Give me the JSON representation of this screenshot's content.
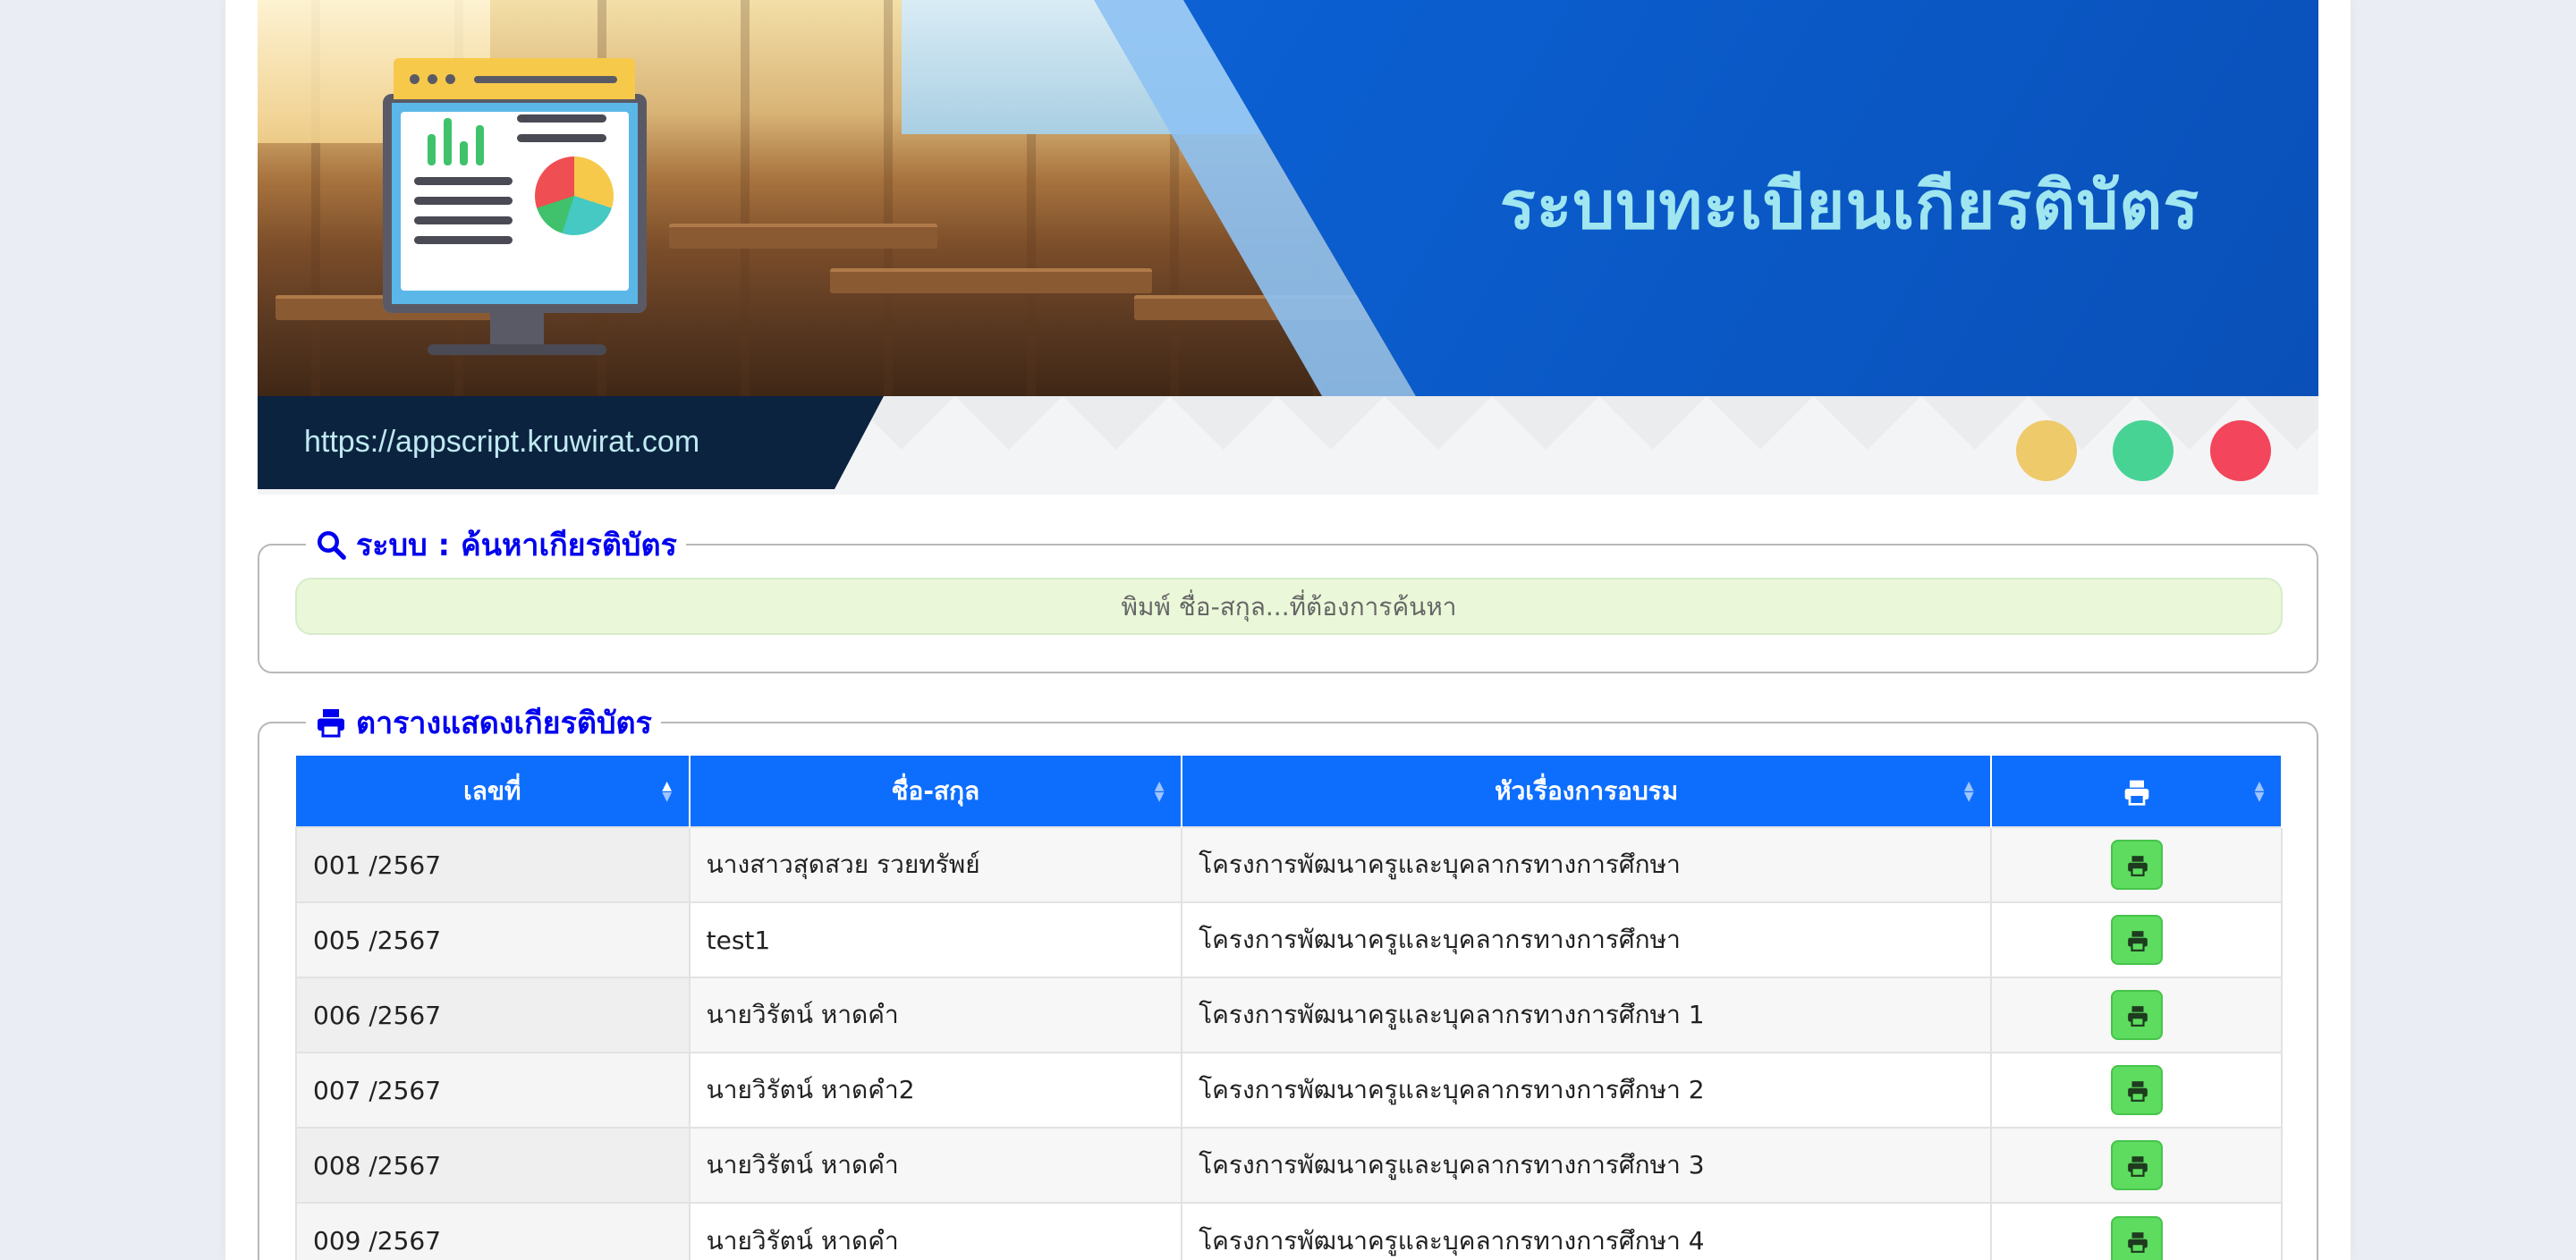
{
  "banner": {
    "title": "ระบบทะเบียนเกียรติบัตร",
    "url": "https://appscript.kruwirat.com"
  },
  "search_section": {
    "legend": "ระบบ : ค้นหาเกียรติบัตร",
    "placeholder": "พิมพ์ ชื่อ-สกุล...ที่ต้องการค้นหา",
    "value": ""
  },
  "table_section": {
    "legend": "ตารางแสดงเกียรติบัตร",
    "columns": [
      "เลขที่",
      "ชื่อ-สกุล",
      "หัวเรื่องการอบรม",
      "print-icon"
    ],
    "rows": [
      {
        "no": "001 /2567",
        "name": "นางสาวสุดสวย รวยทรัพย์",
        "topic": "โครงการพัฒนาครูและบุคลากรทางการศึกษา"
      },
      {
        "no": "005 /2567",
        "name": "test1",
        "topic": "โครงการพัฒนาครูและบุคลากรทางการศึกษา"
      },
      {
        "no": "006 /2567",
        "name": "นายวิรัตน์ หาดคำ",
        "topic": "โครงการพัฒนาครูและบุคลากรทางการศึกษา 1"
      },
      {
        "no": "007 /2567",
        "name": "นายวิรัตน์ หาดคำ2",
        "topic": "โครงการพัฒนาครูและบุคลากรทางการศึกษา 2"
      },
      {
        "no": "008 /2567",
        "name": "นายวิรัตน์ หาดคำ",
        "topic": "โครงการพัฒนาครูและบุคลากรทางการศึกษา 3"
      },
      {
        "no": "009 /2567",
        "name": "นายวิรัตน์ หาดคำ",
        "topic": "โครงการพัฒนาครูและบุคลากรทางการศึกษา 4"
      }
    ]
  },
  "colors": {
    "accent": "#0d6efd",
    "legend": "#0000ee",
    "print_button": "#5ddc5f",
    "search_bg": "#eaf8d9"
  }
}
